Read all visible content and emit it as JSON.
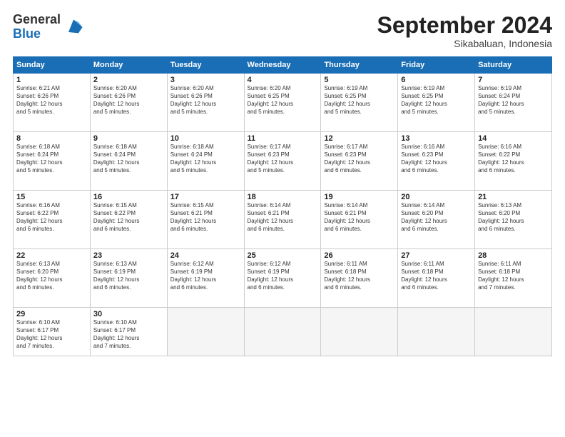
{
  "header": {
    "logo_line1": "General",
    "logo_line2": "Blue",
    "month": "September 2024",
    "location": "Sikabaluan, Indonesia"
  },
  "days_of_week": [
    "Sunday",
    "Monday",
    "Tuesday",
    "Wednesday",
    "Thursday",
    "Friday",
    "Saturday"
  ],
  "weeks": [
    [
      {
        "day": "1",
        "info": "Sunrise: 6:21 AM\nSunset: 6:26 PM\nDaylight: 12 hours\nand 5 minutes."
      },
      {
        "day": "2",
        "info": "Sunrise: 6:20 AM\nSunset: 6:26 PM\nDaylight: 12 hours\nand 5 minutes."
      },
      {
        "day": "3",
        "info": "Sunrise: 6:20 AM\nSunset: 6:26 PM\nDaylight: 12 hours\nand 5 minutes."
      },
      {
        "day": "4",
        "info": "Sunrise: 6:20 AM\nSunset: 6:25 PM\nDaylight: 12 hours\nand 5 minutes."
      },
      {
        "day": "5",
        "info": "Sunrise: 6:19 AM\nSunset: 6:25 PM\nDaylight: 12 hours\nand 5 minutes."
      },
      {
        "day": "6",
        "info": "Sunrise: 6:19 AM\nSunset: 6:25 PM\nDaylight: 12 hours\nand 5 minutes."
      },
      {
        "day": "7",
        "info": "Sunrise: 6:19 AM\nSunset: 6:24 PM\nDaylight: 12 hours\nand 5 minutes."
      }
    ],
    [
      {
        "day": "8",
        "info": "Sunrise: 6:18 AM\nSunset: 6:24 PM\nDaylight: 12 hours\nand 5 minutes."
      },
      {
        "day": "9",
        "info": "Sunrise: 6:18 AM\nSunset: 6:24 PM\nDaylight: 12 hours\nand 5 minutes."
      },
      {
        "day": "10",
        "info": "Sunrise: 6:18 AM\nSunset: 6:24 PM\nDaylight: 12 hours\nand 5 minutes."
      },
      {
        "day": "11",
        "info": "Sunrise: 6:17 AM\nSunset: 6:23 PM\nDaylight: 12 hours\nand 5 minutes."
      },
      {
        "day": "12",
        "info": "Sunrise: 6:17 AM\nSunset: 6:23 PM\nDaylight: 12 hours\nand 6 minutes."
      },
      {
        "day": "13",
        "info": "Sunrise: 6:16 AM\nSunset: 6:23 PM\nDaylight: 12 hours\nand 6 minutes."
      },
      {
        "day": "14",
        "info": "Sunrise: 6:16 AM\nSunset: 6:22 PM\nDaylight: 12 hours\nand 6 minutes."
      }
    ],
    [
      {
        "day": "15",
        "info": "Sunrise: 6:16 AM\nSunset: 6:22 PM\nDaylight: 12 hours\nand 6 minutes."
      },
      {
        "day": "16",
        "info": "Sunrise: 6:15 AM\nSunset: 6:22 PM\nDaylight: 12 hours\nand 6 minutes."
      },
      {
        "day": "17",
        "info": "Sunrise: 6:15 AM\nSunset: 6:21 PM\nDaylight: 12 hours\nand 6 minutes."
      },
      {
        "day": "18",
        "info": "Sunrise: 6:14 AM\nSunset: 6:21 PM\nDaylight: 12 hours\nand 6 minutes."
      },
      {
        "day": "19",
        "info": "Sunrise: 6:14 AM\nSunset: 6:21 PM\nDaylight: 12 hours\nand 6 minutes."
      },
      {
        "day": "20",
        "info": "Sunrise: 6:14 AM\nSunset: 6:20 PM\nDaylight: 12 hours\nand 6 minutes."
      },
      {
        "day": "21",
        "info": "Sunrise: 6:13 AM\nSunset: 6:20 PM\nDaylight: 12 hours\nand 6 minutes."
      }
    ],
    [
      {
        "day": "22",
        "info": "Sunrise: 6:13 AM\nSunset: 6:20 PM\nDaylight: 12 hours\nand 6 minutes."
      },
      {
        "day": "23",
        "info": "Sunrise: 6:13 AM\nSunset: 6:19 PM\nDaylight: 12 hours\nand 6 minutes."
      },
      {
        "day": "24",
        "info": "Sunrise: 6:12 AM\nSunset: 6:19 PM\nDaylight: 12 hours\nand 6 minutes."
      },
      {
        "day": "25",
        "info": "Sunrise: 6:12 AM\nSunset: 6:19 PM\nDaylight: 12 hours\nand 6 minutes."
      },
      {
        "day": "26",
        "info": "Sunrise: 6:11 AM\nSunset: 6:18 PM\nDaylight: 12 hours\nand 6 minutes."
      },
      {
        "day": "27",
        "info": "Sunrise: 6:11 AM\nSunset: 6:18 PM\nDaylight: 12 hours\nand 6 minutes."
      },
      {
        "day": "28",
        "info": "Sunrise: 6:11 AM\nSunset: 6:18 PM\nDaylight: 12 hours\nand 7 minutes."
      }
    ],
    [
      {
        "day": "29",
        "info": "Sunrise: 6:10 AM\nSunset: 6:17 PM\nDaylight: 12 hours\nand 7 minutes."
      },
      {
        "day": "30",
        "info": "Sunrise: 6:10 AM\nSunset: 6:17 PM\nDaylight: 12 hours\nand 7 minutes."
      },
      {
        "day": "",
        "info": ""
      },
      {
        "day": "",
        "info": ""
      },
      {
        "day": "",
        "info": ""
      },
      {
        "day": "",
        "info": ""
      },
      {
        "day": "",
        "info": ""
      }
    ]
  ]
}
